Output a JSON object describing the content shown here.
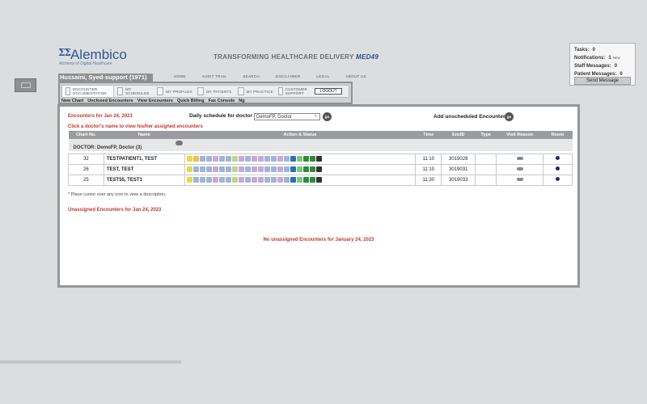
{
  "logo": {
    "mark": "ΣΣ",
    "name": "Alembico",
    "tagline": "Alchemy of Digital Healthcare"
  },
  "header": {
    "tagline": "TRANSFORMING HEALTHCARE DELIVERY",
    "brand": "MED49"
  },
  "top_nav": [
    "HOME",
    "AUDIT TRAIL",
    "SEARCH",
    "DISCLAIMER",
    "LEGAL",
    "ABOUT US"
  ],
  "user": {
    "name": "Hussaini, Syed-support (1971)"
  },
  "nav": {
    "items": [
      "ENCOUNTER DOCUMENTATION",
      "MY SCHEDULES",
      "MY PROFILES",
      "MY PATIENTS",
      "MY PRACTICE",
      "CUSTOMER SUPPORT"
    ],
    "logout_label": "LOGOUT"
  },
  "sub_menu": [
    "New Chart",
    "Unclosed Encounters",
    "View Encounters",
    "Quick Billing",
    "Fax Console",
    "Ng"
  ],
  "notifications": {
    "tasks_label": "Tasks:",
    "tasks": "0",
    "notifications_label": "Notifications:",
    "notifications": "1",
    "new_label": "New",
    "staff_label": "Staff Messages:",
    "staff": "0",
    "patient_label": "Patient Messages:",
    "patient": "0",
    "send_label": "Send Message"
  },
  "encounters": {
    "title": "Encounters for Jan 24, 2023",
    "click_note": "Click a doctor's name to view his/her assigned encounters",
    "daily_label": "Daily schedule for doctor",
    "selected_doctor": "DemoFP, Doctor",
    "go_label": "go",
    "add_label": "Add unscheduled Encounter",
    "columns": [
      "Chart No.",
      "Name",
      "Action & Status",
      "Time",
      "EncID",
      "Type",
      "Visit Reason",
      "Room"
    ],
    "doctor_group": "DOCTOR: DemoFP, Doctor (3)",
    "rows": [
      {
        "chart": "32",
        "name": "TESTPATIENT1, TEST",
        "time": "11:10",
        "enc_id": "3019028"
      },
      {
        "chart": "26",
        "name": "TEST, TEST",
        "time": "11:10",
        "enc_id": "3019031"
      },
      {
        "chart": "25",
        "name": "TEST55, TEST1",
        "time": "11:30",
        "enc_id": "3019033"
      }
    ],
    "hint": "* Place cursor over any icon to view a description.",
    "unassigned_title": "Unassigned Encounters for Jan 24, 2023",
    "none_message": "No unassigned Encounters for January 24, 2023"
  },
  "action_icon_colors": [
    "#e8d84a",
    "#9fb4d8",
    "#9fb4d8",
    "#9fb4d8",
    "#c9a8d8",
    "#9fb4d8",
    "#9fb4d8",
    "#b8d88a",
    "#c9a8d8",
    "#9fb4d8",
    "#c9a8d8",
    "#c9a8d8",
    "#9fb4d8",
    "#9fb4d8",
    "#c9a8d8",
    "#9fb4d8",
    "#2c6fb7",
    "#7fc97f",
    "#2e8b3a",
    "#2e8b3a",
    "#333333"
  ],
  "action_icon_colors_first": [
    "#e8d84a",
    "#f0c040",
    "#9fb4d8",
    "#9fb4d8",
    "#c9a8d8",
    "#9fb4d8",
    "#9fb4d8",
    "#b8d88a",
    "#c9a8d8",
    "#9fb4d8",
    "#c9a8d8",
    "#c9a8d8",
    "#9fb4d8",
    "#9fb4d8",
    "#c9a8d8",
    "#9fb4d8",
    "#2c6fb7",
    "#7fc97f",
    "#2e8b3a",
    "#2e8b3a",
    "#333333"
  ]
}
